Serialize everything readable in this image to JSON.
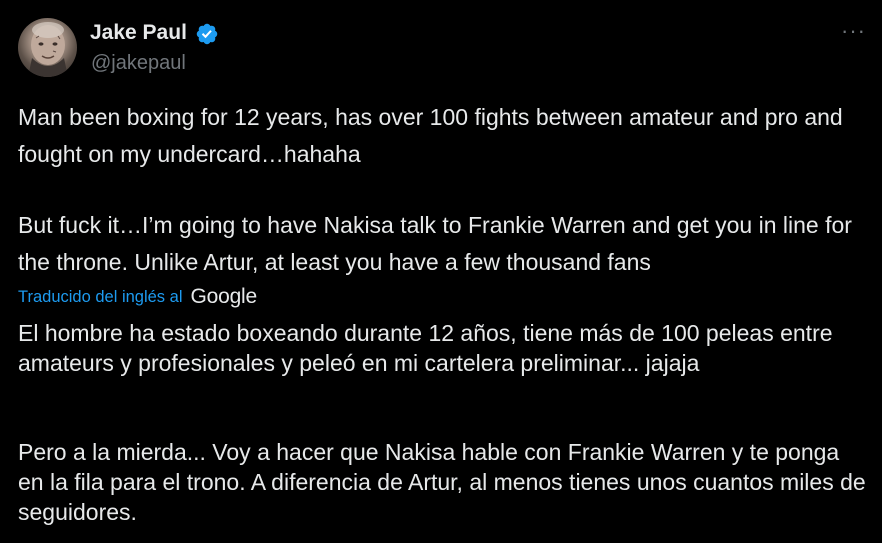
{
  "author": {
    "display_name": "Jake Paul",
    "handle": "@jakepaul",
    "verified_icon": "verified-badge-icon",
    "avatar_icon": "avatar"
  },
  "header": {
    "more_label": "···"
  },
  "tweet": {
    "paragraph_1": "Man been boxing for 12 years, has over 100 fights between amateur and pro and fought on my undercard…hahaha",
    "paragraph_2": "But fuck it…I’m going to have Nakisa talk to Frankie Warren and get you in line for the throne. Unlike Artur, at least you have a few thousand fans"
  },
  "translation": {
    "label": "Traducido del inglés al",
    "provider": "Google",
    "paragraph_1": "El hombre ha estado boxeando durante 12 años, tiene más de 100 peleas entre amateurs y profesionales y peleó en mi cartelera preliminar... jajaja",
    "paragraph_2": "Pero a la mierda... Voy a hacer que Nakisa hable con Frankie Warren y te ponga en la fila para el trono. A diferencia de Artur, al menos tienes unos cuantos miles de seguidores."
  },
  "colors": {
    "background": "#000000",
    "text": "#e7e9ea",
    "secondary": "#71767b",
    "accent": "#1d9bf0"
  }
}
